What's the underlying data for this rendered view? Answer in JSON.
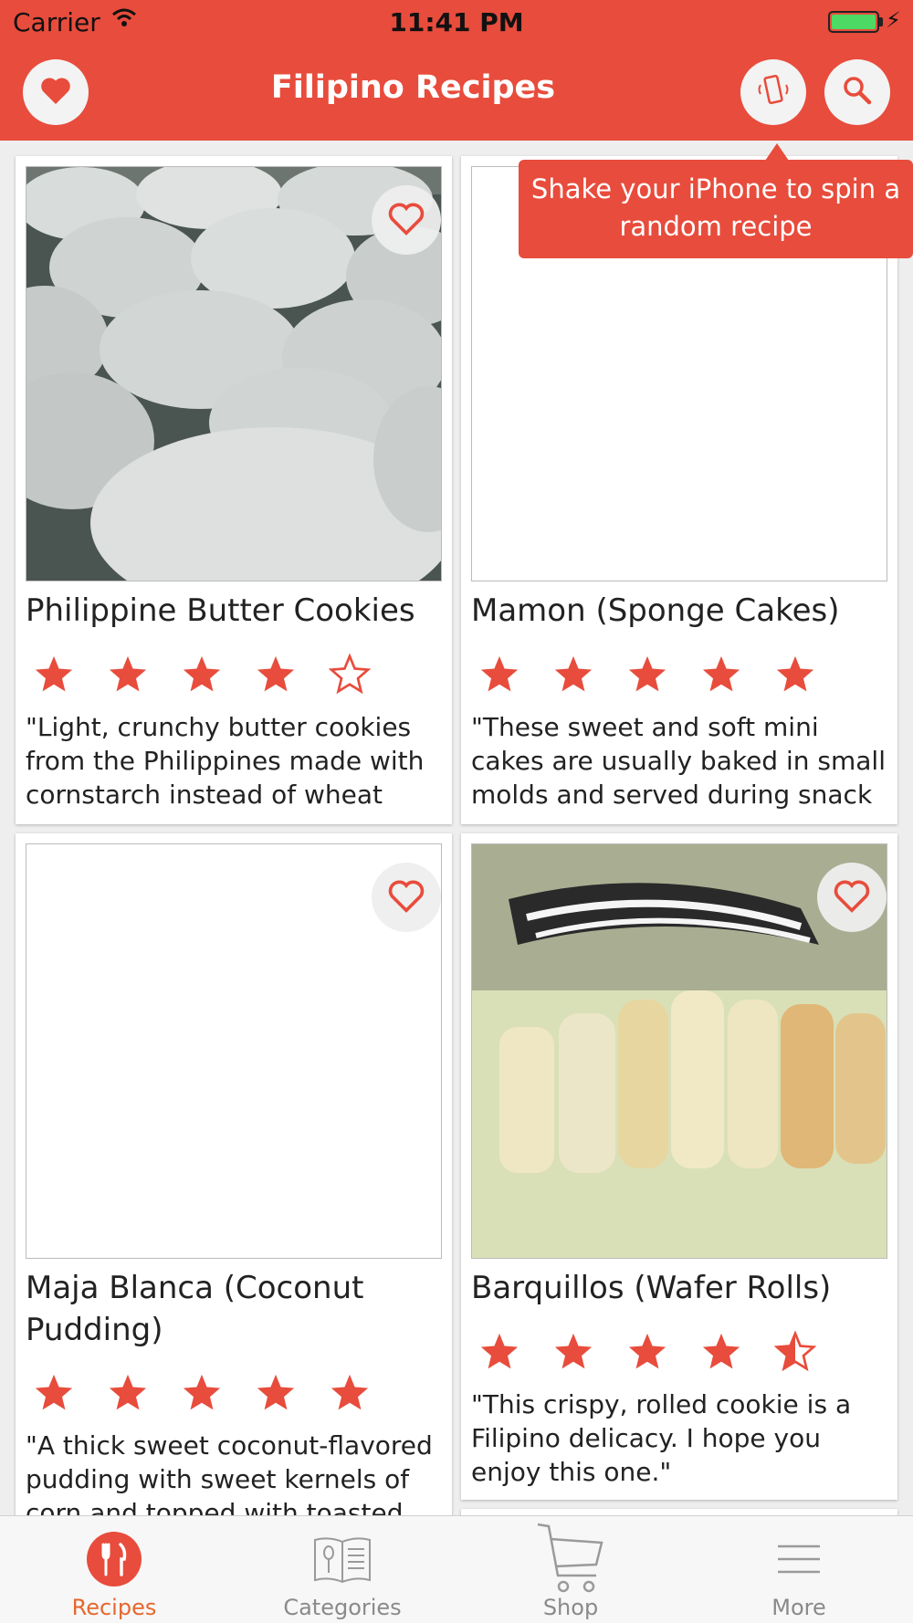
{
  "status_bar": {
    "carrier": "Carrier",
    "time": "11:41 PM"
  },
  "header": {
    "title": "Filipino Recipes",
    "favorites_icon": "heart-icon",
    "shake_icon": "shake-phone-icon",
    "search_icon": "search-icon"
  },
  "tooltip": {
    "text": "Shake your iPhone to spin a random recipe"
  },
  "recipes": [
    {
      "name": "Philippine Butter Cookies",
      "rating": 4,
      "description": "\"Light, crunchy butter cookies from the Philippines made with cornstarch instead of wheat flour.\"",
      "has_photo": true
    },
    {
      "name": "Mamon (Sponge Cakes)",
      "rating": 5,
      "description": "\"These sweet and soft mini cakes are usually baked in small molds and served during snack time. U…",
      "has_photo": false
    },
    {
      "name": "Maja Blanca (Coconut Pudding)",
      "rating": 5,
      "description": "\"A thick sweet coconut-flavored pudding with sweet kernels of corn and topped with toasted c…",
      "has_photo": false
    },
    {
      "name": "Barquillos (Wafer Rolls)",
      "rating": 4.5,
      "description": "\"This crispy, rolled cookie is a Filipino delicacy. I hope you enjoy this one.\"",
      "has_photo": true
    }
  ],
  "tabs": [
    {
      "label": "Recipes",
      "icon": "fork-knife-icon",
      "active": true
    },
    {
      "label": "Categories",
      "icon": "recipe-book-icon",
      "active": false
    },
    {
      "label": "Shop",
      "icon": "shopping-cart-icon",
      "active": false
    },
    {
      "label": "More",
      "icon": "menu-lines-icon",
      "active": false
    }
  ],
  "colors": {
    "brand": "#e84c3c",
    "active_tab": "#e6672e",
    "inactive_tab": "#8a8a8a"
  }
}
